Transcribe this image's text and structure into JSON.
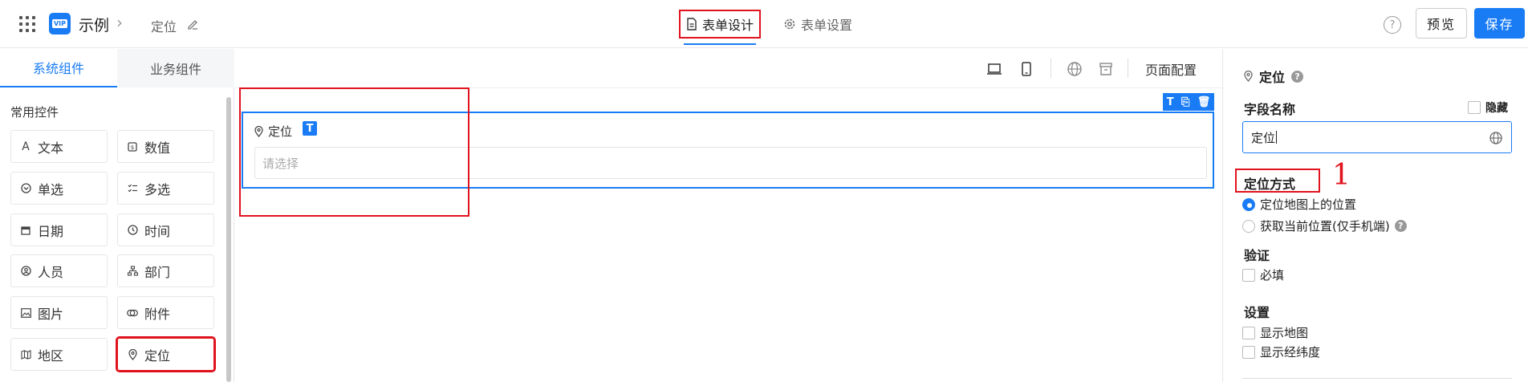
{
  "header": {
    "app_name": "示例",
    "form_name": "定位",
    "tab_design": "表单设计",
    "tab_settings": "表单设置",
    "preview_label": "预览",
    "save_label": "保存",
    "help_glyph": "?"
  },
  "left_panel": {
    "tabs": [
      "系统组件",
      "业务组件"
    ],
    "section_title": "常用控件",
    "components": [
      {
        "label": "文本",
        "icon": "text-icon"
      },
      {
        "label": "数值",
        "icon": "number-icon"
      },
      {
        "label": "单选",
        "icon": "radio-icon"
      },
      {
        "label": "多选",
        "icon": "checklist-icon"
      },
      {
        "label": "日期",
        "icon": "calendar-icon"
      },
      {
        "label": "时间",
        "icon": "clock-icon"
      },
      {
        "label": "人员",
        "icon": "person-icon"
      },
      {
        "label": "部门",
        "icon": "org-icon"
      },
      {
        "label": "图片",
        "icon": "image-icon"
      },
      {
        "label": "附件",
        "icon": "link-icon"
      },
      {
        "label": "地区",
        "icon": "map-icon"
      },
      {
        "label": "定位",
        "icon": "location-pin-icon"
      }
    ]
  },
  "canvas": {
    "page_config_label": "页面配置",
    "field_label": "定位",
    "field_placeholder": "请选择",
    "badge_glyph": "T"
  },
  "right_panel": {
    "title": "定位",
    "field_name_label": "字段名称",
    "hide_label": "隐藏",
    "field_name_value": "定位",
    "location_mode_label": "定位方式",
    "annotation_number": "1",
    "location_options": [
      "定位地图上的位置",
      "获取当前位置(仅手机端)"
    ],
    "selected_option_index": 0,
    "validation_label": "验证",
    "required_label": "必填",
    "settings_label": "设置",
    "show_map_label": "显示地图",
    "show_coords_label": "显示经纬度"
  },
  "colors": {
    "accent": "#1a7cf5",
    "annotation_red": "#e0121d"
  }
}
